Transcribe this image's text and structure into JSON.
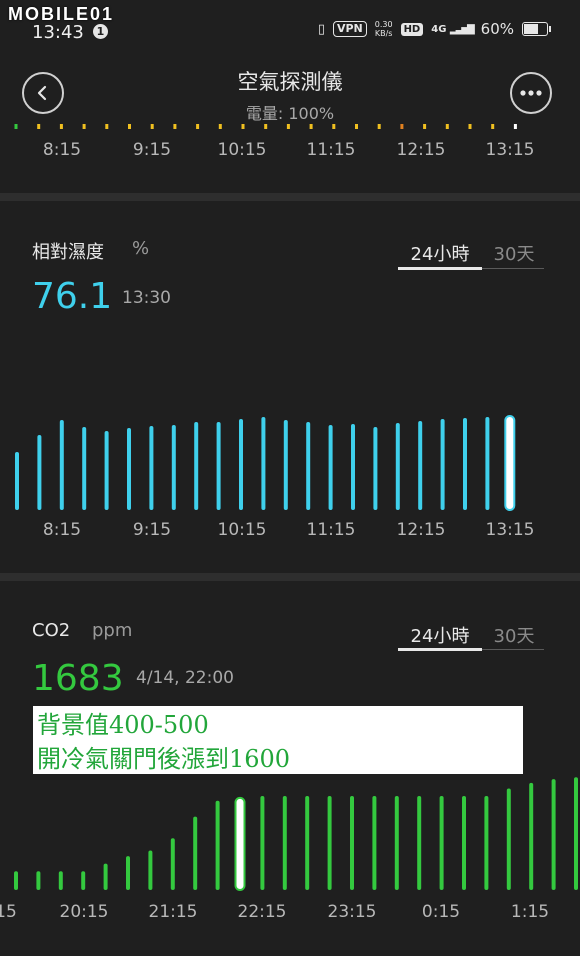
{
  "status_bar": {
    "watermark": "MOBILE01",
    "time": "13:43",
    "notification_count": "1",
    "vpn": "VPN",
    "speed_value": "0.30",
    "speed_unit": "KB/s",
    "hd": "HD",
    "network": "4G",
    "battery": "60%"
  },
  "header": {
    "title": "空氣探測儀",
    "subtitle": "電量: 100%"
  },
  "top_chart": {
    "ticks": [
      "8:15",
      "9:15",
      "10:15",
      "11:15",
      "12:15",
      "13:15"
    ]
  },
  "humidity": {
    "title": "相對濕度",
    "unit": "%",
    "value": "76.1",
    "timestamp": "13:30",
    "tabs": [
      "24小時",
      "30天"
    ],
    "color": "#3fd0ec",
    "ticks": [
      "8:15",
      "9:15",
      "10:15",
      "11:15",
      "12:15",
      "13:15"
    ],
    "chart_data": {
      "type": "bar",
      "series_level": [
        0.58,
        0.75,
        0.9,
        0.83,
        0.79,
        0.82,
        0.84,
        0.85,
        0.88,
        0.88,
        0.91,
        0.93,
        0.9,
        0.88,
        0.85,
        0.86,
        0.83,
        0.87,
        0.89,
        0.91,
        0.92,
        0.93,
        0.94
      ]
    }
  },
  "co2": {
    "title": "CO2",
    "unit": "ppm",
    "value": "1683",
    "timestamp": "4/14, 22:00",
    "tabs": [
      "24小時",
      "30天"
    ],
    "color": "#34c93f",
    "note_lines": [
      "背景值400-500",
      "開冷氣關門後漲到1600"
    ],
    "ticks": [
      "15",
      "20:15",
      "21:15",
      "22:15",
      "23:15",
      "0:15",
      "1:15"
    ],
    "chart_data": {
      "type": "bar",
      "series_level": [
        0.2,
        0.2,
        0.2,
        0.2,
        0.28,
        0.36,
        0.42,
        0.55,
        0.78,
        0.95,
        0.98,
        1.0,
        1.0,
        1.0,
        1.0,
        1.0,
        1.0,
        1.0,
        1.0,
        1.0,
        1.0,
        1.0,
        1.08,
        1.14,
        1.18,
        1.2
      ]
    }
  }
}
